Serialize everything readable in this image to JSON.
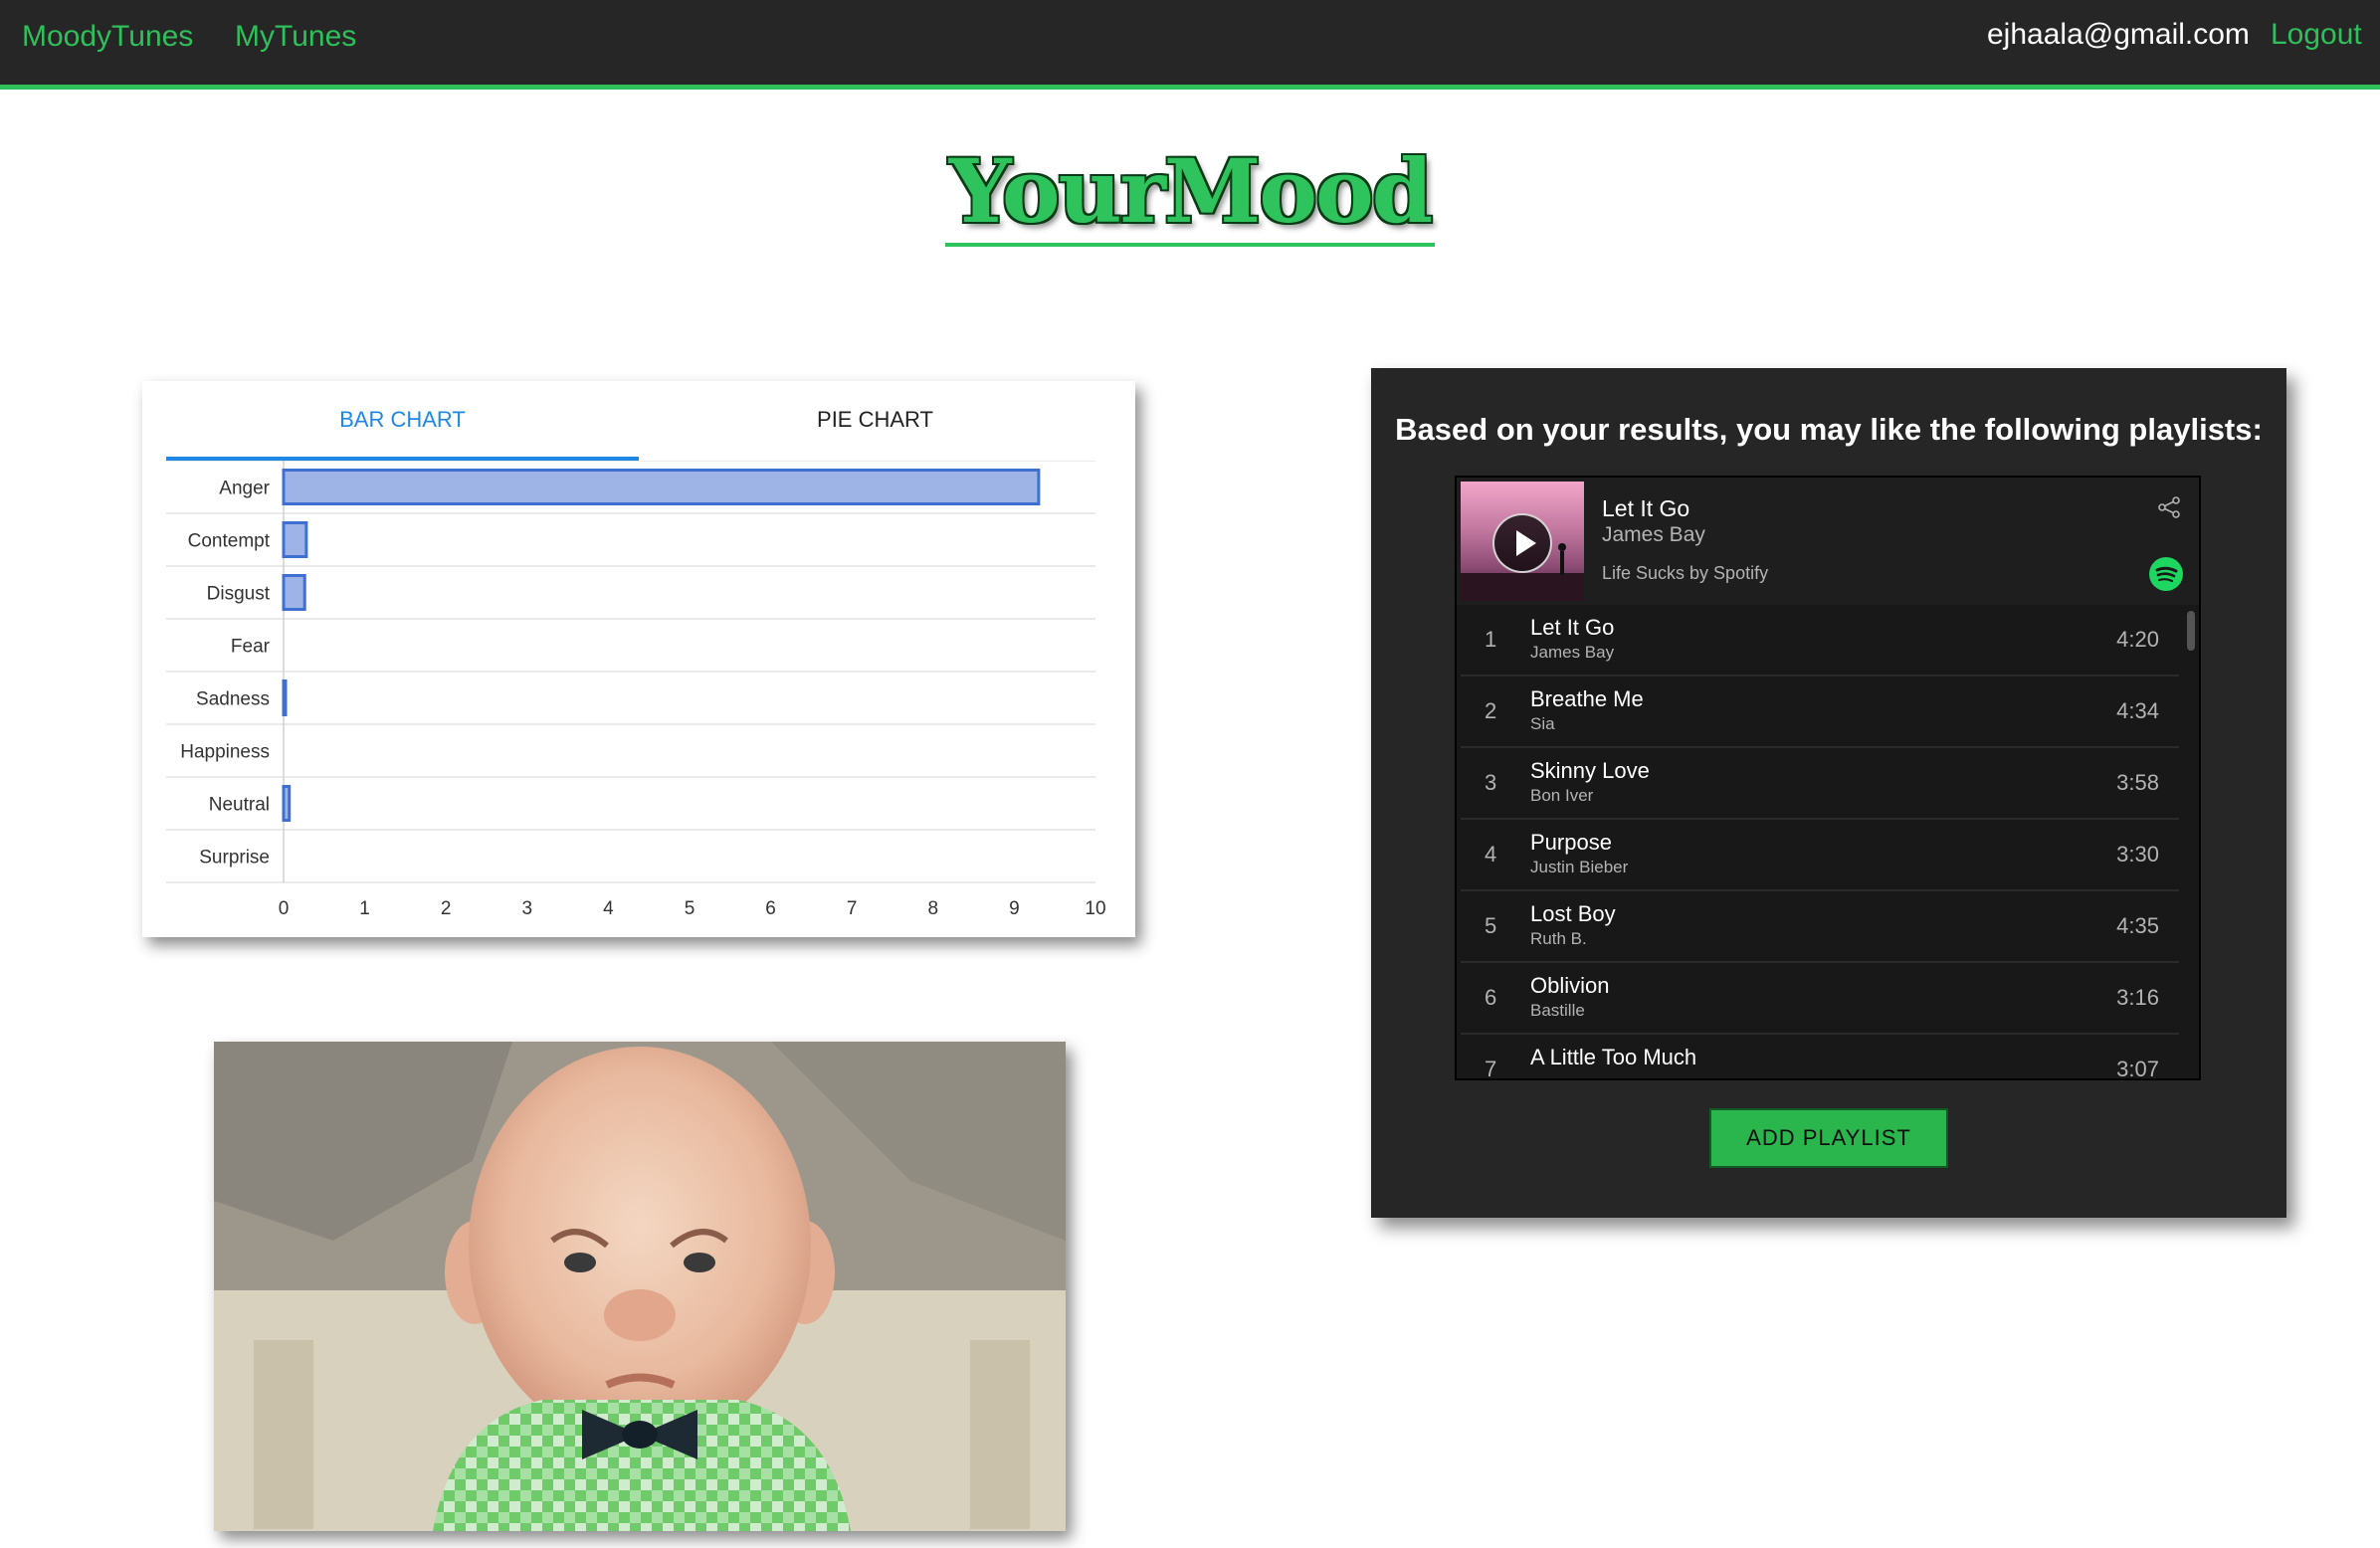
{
  "nav": {
    "brand": "MoodyTunes",
    "mytunes": "MyTunes",
    "email": "ejhaala@gmail.com",
    "logout": "Logout"
  },
  "page": {
    "title": "YourMood"
  },
  "tabs": {
    "bar": "BAR CHART",
    "pie": "PIE CHART"
  },
  "chart_data": {
    "type": "bar",
    "orientation": "horizontal",
    "categories": [
      "Anger",
      "Contempt",
      "Disgust",
      "Fear",
      "Sadness",
      "Happiness",
      "Neutral",
      "Surprise"
    ],
    "values": [
      9.3,
      0.28,
      0.26,
      0,
      0.02,
      0,
      0.07,
      0
    ],
    "xticks": [
      "0",
      "1",
      "2",
      "3",
      "4",
      "5",
      "6",
      "7",
      "8",
      "9",
      "10"
    ],
    "xlim": [
      0,
      10
    ],
    "grid": true,
    "bar_color": "#9eb4e6",
    "bar_border": "#3f6fd1"
  },
  "playlist": {
    "heading": "Based on your results, you may like the following playlists:",
    "now_playing": {
      "title": "Let It Go",
      "artist": "James Bay",
      "source": "Life Sucks by Spotify"
    },
    "tracks": [
      {
        "num": "1",
        "name": "Let It Go",
        "artist": "James Bay",
        "duration": "4:20"
      },
      {
        "num": "2",
        "name": "Breathe Me",
        "artist": "Sia",
        "duration": "4:34"
      },
      {
        "num": "3",
        "name": "Skinny Love",
        "artist": "Bon Iver",
        "duration": "3:58"
      },
      {
        "num": "4",
        "name": "Purpose",
        "artist": "Justin Bieber",
        "duration": "3:30"
      },
      {
        "num": "5",
        "name": "Lost Boy",
        "artist": "Ruth B.",
        "duration": "4:35"
      },
      {
        "num": "6",
        "name": "Oblivion",
        "artist": "Bastille",
        "duration": "3:16"
      },
      {
        "num": "7",
        "name": "A Little Too Much",
        "artist": "",
        "duration": "3:07"
      }
    ],
    "add_button": "ADD PLAYLIST",
    "accent": "#1ed760"
  }
}
